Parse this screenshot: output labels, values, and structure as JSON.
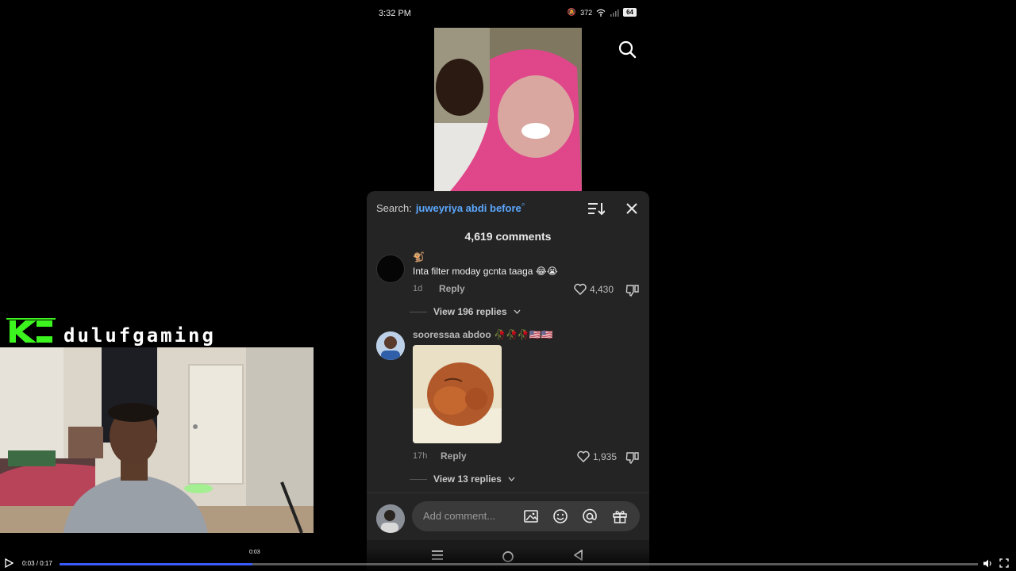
{
  "status_bar": {
    "time": "3:32 PM",
    "net_speed": "372",
    "battery": "64"
  },
  "sheet": {
    "search_label": "Search:",
    "search_term": "juweyriya abdi before",
    "comments_count": "4,619 comments",
    "comments": [
      {
        "username": "🐒",
        "text": "Inta filter moday gcnta taaga 😂😭",
        "time": "1d",
        "reply_label": "Reply",
        "likes": "4,430",
        "view_replies": "View 196 replies"
      },
      {
        "username": "sooressaa abdoo 🥀🥀🥀🇺🇸🇺🇸",
        "time": "17h",
        "reply_label": "Reply",
        "likes": "1,935",
        "view_replies": "View 13 replies"
      }
    ],
    "add_comment_placeholder": "Add comment..."
  },
  "overlay": {
    "channel_name": "dulufgaming"
  },
  "player": {
    "time": "0:03 / 0:17",
    "hover_time": "0:03",
    "progress": 0.21
  },
  "icons": [
    "search-icon",
    "sort-icon",
    "close-icon",
    "heart-icon",
    "dislike-icon",
    "chevron-down-icon",
    "image-icon",
    "emoji-icon",
    "mention-icon",
    "gift-icon",
    "menu-icon",
    "home-icon",
    "back-icon",
    "play-icon",
    "volume-icon",
    "fullscreen-icon"
  ],
  "colors": {
    "search_term": "#5ba8ff",
    "progress": "#3b5bff",
    "sheet_bg": "#242424"
  }
}
